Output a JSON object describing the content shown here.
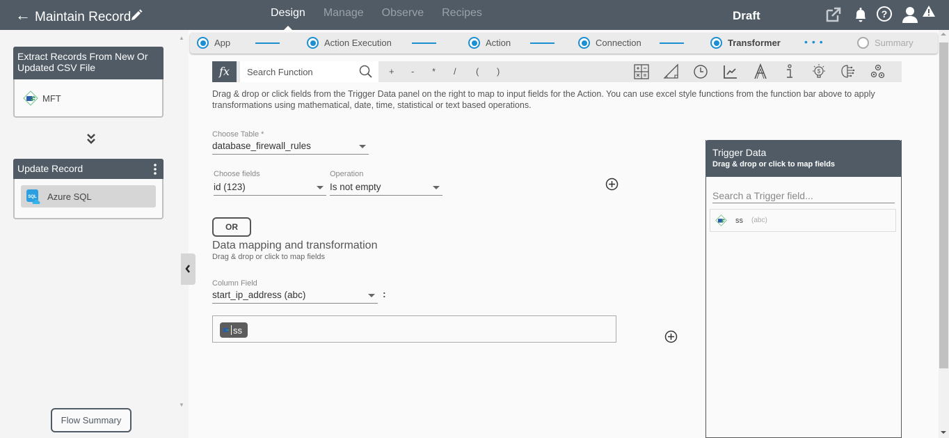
{
  "header": {
    "back_icon": "arrow-left-icon",
    "title": "Maintain Record",
    "edit_icon": "pencil-icon",
    "tabs": [
      {
        "label": "Design",
        "active": true
      },
      {
        "label": "Manage",
        "active": false
      },
      {
        "label": "Observe",
        "active": false
      },
      {
        "label": "Recipes",
        "active": false
      }
    ],
    "status": "Draft",
    "icons": [
      "external-link-icon",
      "bell-icon",
      "help-icon",
      "user-icon",
      "warning-icon"
    ]
  },
  "sidebar": {
    "trigger_card": {
      "title": "Extract Records From New Or Updated CSV File",
      "app_label": "MFT",
      "app_icon": "mft-icon"
    },
    "flow_icon": "chevron-double-down-icon",
    "action_card": {
      "title": "Update Record",
      "menu_icon": "kebab-menu-icon",
      "app_label": "Azure SQL",
      "app_icon": "azure-sql-icon"
    },
    "flow_summary_label": "Flow Summary",
    "collapse_icon": "chevron-left-icon"
  },
  "stepper": {
    "steps": [
      {
        "label": "App",
        "state": "done"
      },
      {
        "label": "Action Execution",
        "state": "done"
      },
      {
        "label": "Action",
        "state": "done"
      },
      {
        "label": "Connection",
        "state": "done"
      },
      {
        "label": "Transformer",
        "state": "current"
      },
      {
        "label": "Summary",
        "state": "pending"
      }
    ]
  },
  "function_bar": {
    "fx_label": "fx",
    "search_placeholder": "Search Function",
    "operators": [
      "+",
      "-",
      "*",
      "/",
      "(",
      ")"
    ],
    "tools": [
      "calculator-icon",
      "trigonometry-icon",
      "clock-icon",
      "line-chart-icon",
      "text-icon",
      "info-icon",
      "finance-bulb-icon",
      "ai-brain-icon",
      "settings-gears-icon"
    ]
  },
  "help_text": "Drag & drop or click fields from the Trigger Data panel on the right to map to input fields for the Action. You can use excel style functions from the function bar above to apply transformations using mathematical, date, time, statistical or text based operations.",
  "form": {
    "table_label": "Choose Table *",
    "table_value": "database_firewall_rules",
    "fields_label": "Choose fields",
    "fields_value": "id (123)",
    "operation_label": "Operation",
    "operation_value": "Is not empty",
    "or_label": "OR",
    "mapping_title": "Data mapping and transformation",
    "mapping_sub": "Drag & drop or click to map fields",
    "column_label": "Column Field",
    "column_value": "start_ip_address (abc)",
    "colon": ":",
    "mapped_chip": "ss"
  },
  "trigger_panel": {
    "title": "Trigger Data",
    "subtitle": "Drag & drop or click to map fields",
    "search_placeholder": "Search a Trigger field...",
    "items": [
      {
        "name": "ss",
        "type": "(abc)",
        "icon": "mft-icon"
      }
    ]
  }
}
